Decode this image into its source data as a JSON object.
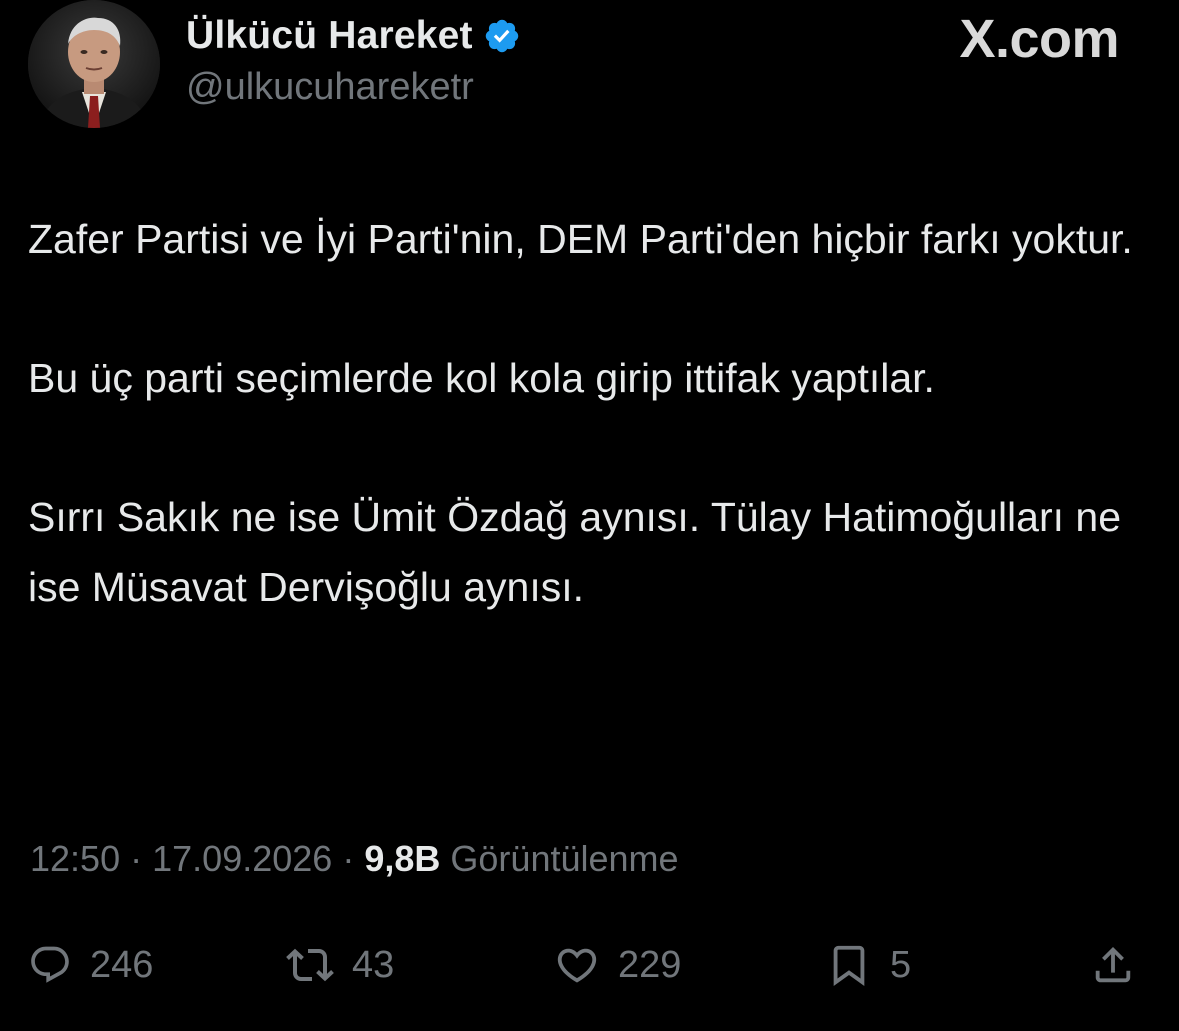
{
  "header": {
    "display_name": "Ülkücü Hareket",
    "handle": "@ulkucuhareketr",
    "brand": "X.com",
    "verified": true,
    "verified_color": "#1d9bf0"
  },
  "tweet": {
    "paragraphs": [
      "Zafer Partisi ve İyi Parti'nin, DEM Parti'den hiçbir farkı yoktur.",
      "Bu üç parti seçimlerde kol kola girip ittifak yaptılar.",
      "Sırrı Sakık ne ise Ümit Özdağ aynısı. Tülay Hatimoğulları ne ise Müsavat Dervişoğlu aynısı."
    ]
  },
  "meta": {
    "time": "12:50",
    "separator": "·",
    "date": "17.09.2026",
    "views_count": "9,8B",
    "views_label": "Görüntülenme"
  },
  "actions": {
    "replies": "246",
    "retweets": "43",
    "likes": "229",
    "bookmarks": "5"
  },
  "colors": {
    "background": "#000000",
    "text_primary": "#e7e9ea",
    "text_secondary": "#71767b"
  }
}
